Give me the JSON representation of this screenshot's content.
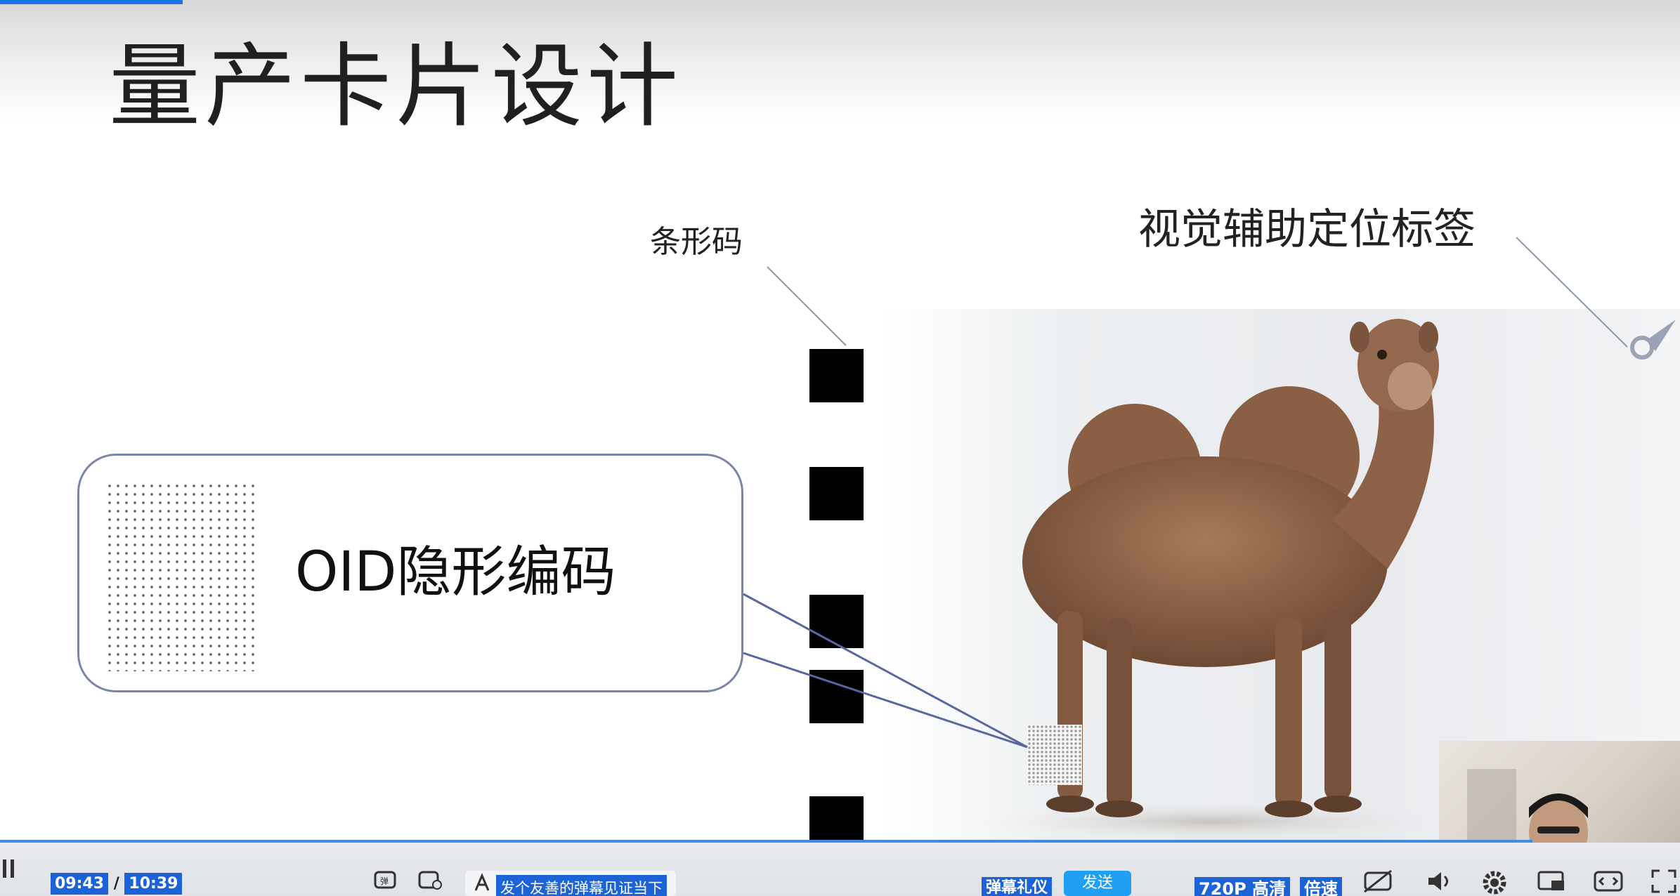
{
  "slide": {
    "title": "量产卡片设计",
    "label_barcode": "条形码",
    "label_visual_tag": "视觉辅助定位标签",
    "bubble_text": "OID隐形编码"
  },
  "player": {
    "current_time": "09:43",
    "separator": "/",
    "total_time": "10:39",
    "danmaku_placeholder": "发个友善的弹幕见证当下",
    "danmaku_etiquette": "弹幕礼仪",
    "send_label": "发送",
    "quality_label": "720P 高清",
    "speed_label": "倍速",
    "progress_fraction": 0.912
  },
  "icons": {
    "play_pause": "pause-icon",
    "danmaku_toggle": "danmaku-toggle-icon",
    "danmaku_settings": "danmaku-settings-icon",
    "text_style": "text-style-icon",
    "subtitle": "subtitle-off-icon",
    "volume": "volume-icon",
    "settings": "gear-icon",
    "pip": "picture-in-picture-icon",
    "widescreen": "widescreen-icon",
    "fullscreen": "fullscreen-icon"
  },
  "colors": {
    "accent": "#1b63d6",
    "progress": "#3f8ce0",
    "connector": "#5a66a0"
  }
}
